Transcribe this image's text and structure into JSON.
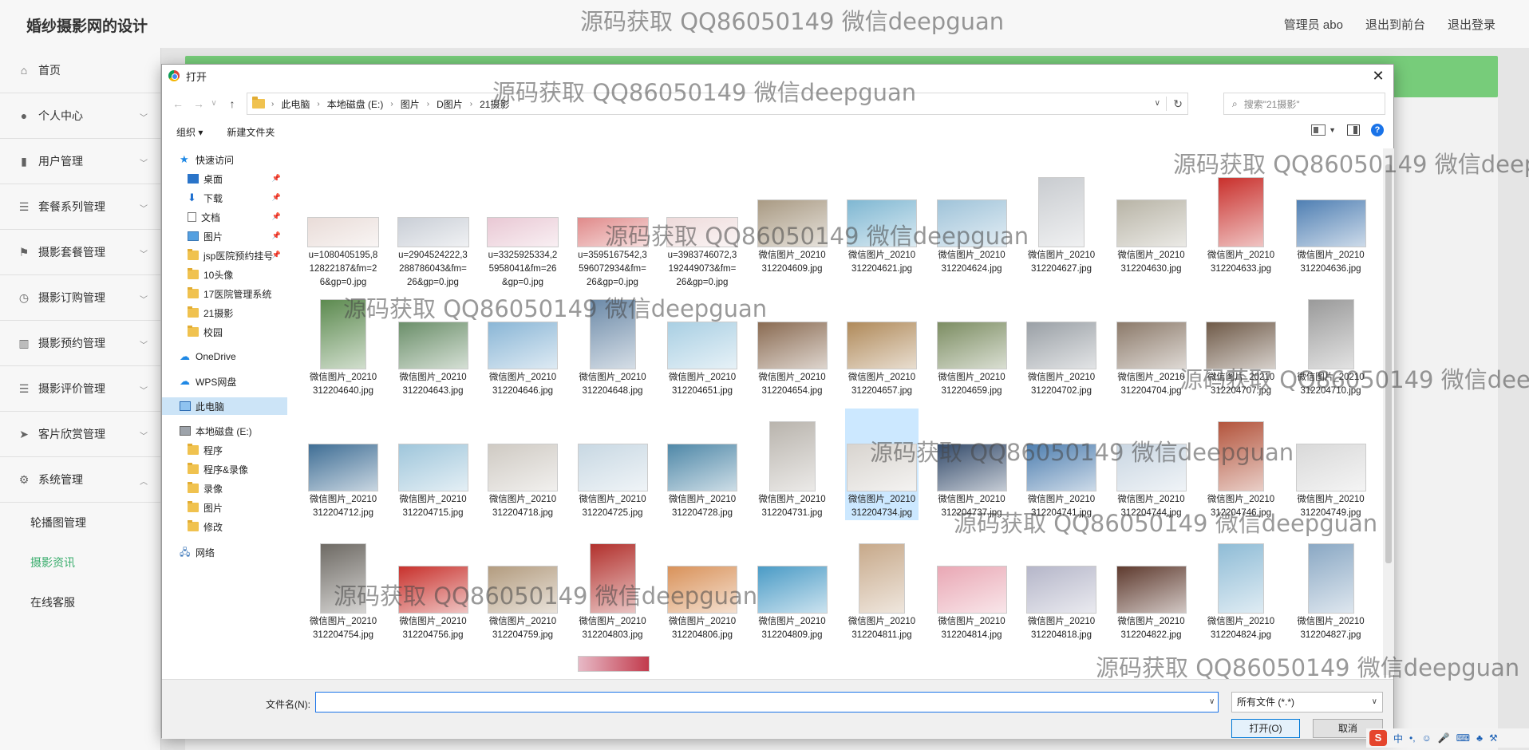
{
  "app": {
    "title": "婚纱摄影网的设计",
    "header_links": [
      "管理员 abo",
      "退出到前台",
      "退出登录"
    ],
    "sidebar": [
      {
        "label": "首页",
        "icon": "home-icon"
      },
      {
        "label": "个人中心",
        "icon": "user-icon"
      },
      {
        "label": "用户管理",
        "icon": "chart-icon"
      },
      {
        "label": "套餐系列管理",
        "icon": "list-icon"
      },
      {
        "label": "摄影套餐管理",
        "icon": "flag-icon"
      },
      {
        "label": "摄影订购管理",
        "icon": "clock-icon"
      },
      {
        "label": "摄影预约管理",
        "icon": "bars-icon"
      },
      {
        "label": "摄影评价管理",
        "icon": "list-icon"
      },
      {
        "label": "客片欣赏管理",
        "icon": "send-icon"
      },
      {
        "label": "系统管理",
        "icon": "gear-icon"
      }
    ],
    "sidebar_sub": [
      "轮播图管理",
      "摄影资讯",
      "在线客服"
    ],
    "sidebar_active_sub": "摄影资讯"
  },
  "dialog": {
    "title": "打开",
    "breadcrumb": [
      "此电脑",
      "本地磁盘 (E:)",
      "图片",
      "D图片",
      "21摄影"
    ],
    "search_placeholder": "搜索\"21摄影\"",
    "toolbar": {
      "organize": "组织 ▾",
      "new_folder": "新建文件夹"
    },
    "nav_items": [
      {
        "label": "快速访问",
        "icon": "star"
      },
      {
        "label": "桌面",
        "icon": "desktop",
        "pinned": true
      },
      {
        "label": "下载",
        "icon": "download",
        "pinned": true
      },
      {
        "label": "文档",
        "icon": "document",
        "pinned": true
      },
      {
        "label": "图片",
        "icon": "pictures",
        "pinned": true
      },
      {
        "label": "jsp医院预约挂号",
        "icon": "folder",
        "pinned": true
      },
      {
        "label": "10头像",
        "icon": "folder"
      },
      {
        "label": "17医院管理系统",
        "icon": "folder"
      },
      {
        "label": "21摄影",
        "icon": "folder"
      },
      {
        "label": "校园",
        "icon": "folder"
      },
      {
        "label": "OneDrive",
        "icon": "cloud"
      },
      {
        "label": "WPS网盘",
        "icon": "cloud"
      },
      {
        "label": "此电脑",
        "icon": "pc",
        "selected": true
      },
      {
        "label": "本地磁盘 (E:)",
        "icon": "drive"
      },
      {
        "label": "程序",
        "icon": "folder"
      },
      {
        "label": "程序&录像",
        "icon": "folder"
      },
      {
        "label": "录像",
        "icon": "folder"
      },
      {
        "label": "图片",
        "icon": "folder"
      },
      {
        "label": "修改",
        "icon": "folder"
      },
      {
        "label": "网络",
        "icon": "network"
      }
    ],
    "files": [
      {
        "name": "u=1080405195,812822187&fm=26&gp=0.jpg",
        "shape": "strip",
        "color": "#e9dcd8"
      },
      {
        "name": "u=2904524222,3288786043&fm=26&gp=0.jpg",
        "shape": "strip",
        "color": "#c9ced6"
      },
      {
        "name": "u=3325925334,25958041&fm=26&gp=0.jpg",
        "shape": "strip",
        "color": "#e9c8d4"
      },
      {
        "name": "u=3595167542,3596072934&fm=26&gp=0.jpg",
        "shape": "strip",
        "color": "#e08a8a"
      },
      {
        "name": "u=3983746072,3192449073&fm=26&gp=0.jpg",
        "shape": "strip",
        "color": "#eedada"
      },
      {
        "name": "微信图片_20210312204609.jpg",
        "shape": "wide",
        "color": "#a99a83"
      },
      {
        "name": "微信图片_20210312204621.jpg",
        "shape": "wide",
        "color": "#7fb7d2"
      },
      {
        "name": "微信图片_20210312204624.jpg",
        "shape": "wide",
        "color": "#9fc3d9"
      },
      {
        "name": "微信图片_20210312204627.jpg",
        "shape": "tall",
        "color": "#c9ccd0"
      },
      {
        "name": "微信图片_20210312204630.jpg",
        "shape": "wide",
        "color": "#b8b4a6"
      },
      {
        "name": "微信图片_20210312204633.jpg",
        "shape": "tall",
        "color": "#c9302c"
      },
      {
        "name": "微信图片_20210312204636.jpg",
        "shape": "wide",
        "color": "#4f7fb3"
      },
      {
        "name": "微信图片_20210312204640.jpg",
        "shape": "tall",
        "color": "#5c8a4f"
      },
      {
        "name": "微信图片_20210312204643.jpg",
        "shape": "wide",
        "color": "#6b8f6a"
      },
      {
        "name": "微信图片_20210312204646.jpg",
        "shape": "wide",
        "color": "#8ab6d6"
      },
      {
        "name": "微信图片_20210312204648.jpg",
        "shape": "tall",
        "color": "#6c8aa8"
      },
      {
        "name": "微信图片_20210312204651.jpg",
        "shape": "wide",
        "color": "#a9cfe3"
      },
      {
        "name": "微信图片_20210312204654.jpg",
        "shape": "wide",
        "color": "#8a6b52"
      },
      {
        "name": "微信图片_20210312204657.jpg",
        "shape": "wide",
        "color": "#b08a5a"
      },
      {
        "name": "微信图片_20210312204659.jpg",
        "shape": "wide",
        "color": "#7c8d62"
      },
      {
        "name": "微信图片_20210312204702.jpg",
        "shape": "wide",
        "color": "#9aa0a6"
      },
      {
        "name": "微信图片_20210312204704.jpg",
        "shape": "wide",
        "color": "#8c7a6a"
      },
      {
        "name": "微信图片_20210312204707.jpg",
        "shape": "wide",
        "color": "#6f5a48"
      },
      {
        "name": "微信图片_20210312204710.jpg",
        "shape": "tall",
        "color": "#9a9a9a"
      },
      {
        "name": "微信图片_20210312204712.jpg",
        "shape": "wide",
        "color": "#3f6e95"
      },
      {
        "name": "微信图片_20210312204715.jpg",
        "shape": "wide",
        "color": "#9fc6db"
      },
      {
        "name": "微信图片_20210312204718.jpg",
        "shape": "wide",
        "color": "#cfcac3"
      },
      {
        "name": "微信图片_20210312204725.jpg",
        "shape": "wide",
        "color": "#c8d8e3"
      },
      {
        "name": "微信图片_20210312204728.jpg",
        "shape": "wide",
        "color": "#4f88a8"
      },
      {
        "name": "微信图片_20210312204731.jpg",
        "shape": "tall",
        "color": "#b9b4ad"
      },
      {
        "name": "微信图片_20210312204734.jpg",
        "shape": "wide",
        "color": "#d8d4cf",
        "selected": true
      },
      {
        "name": "微信图片_20210312204737.jpg",
        "shape": "wide",
        "color": "#334a6a"
      },
      {
        "name": "微信图片_20210312204741.jpg",
        "shape": "wide",
        "color": "#4f7fb0"
      },
      {
        "name": "微信图片_20210312204744.jpg",
        "shape": "wide",
        "color": "#c9d6e2"
      },
      {
        "name": "微信图片_20210312204746.jpg",
        "shape": "tall",
        "color": "#b3543c"
      },
      {
        "name": "微信图片_20210312204749.jpg",
        "shape": "wide",
        "color": "#d9d9d9"
      },
      {
        "name": "微信图片_20210312204754.jpg",
        "shape": "tall",
        "color": "#6e6a64"
      },
      {
        "name": "微信图片_20210312204756.jpg",
        "shape": "wide",
        "color": "#c8312c"
      },
      {
        "name": "微信图片_20210312204759.jpg",
        "shape": "wide",
        "color": "#b39c7f"
      },
      {
        "name": "微信图片_20210312204803.jpg",
        "shape": "tall",
        "color": "#b2312d"
      },
      {
        "name": "微信图片_20210312204806.jpg",
        "shape": "wide",
        "color": "#d9925a"
      },
      {
        "name": "微信图片_20210312204809.jpg",
        "shape": "wide",
        "color": "#4a9bc6"
      },
      {
        "name": "微信图片_20210312204811.jpg",
        "shape": "tall",
        "color": "#c7a98a"
      },
      {
        "name": "微信图片_20210312204814.jpg",
        "shape": "wide",
        "color": "#e9a7b4"
      },
      {
        "name": "微信图片_20210312204818.jpg",
        "shape": "wide",
        "color": "#b5b6c9"
      },
      {
        "name": "微信图片_20210312204822.jpg",
        "shape": "wide",
        "color": "#5e3a2e"
      },
      {
        "name": "微信图片_20210312204824.jpg",
        "shape": "tall",
        "color": "#8fbcd6"
      },
      {
        "name": "微信图片_20210312204827.jpg",
        "shape": "tall",
        "color": "#8aa8c4"
      }
    ],
    "filename_label": "文件名(N):",
    "filename_value": "",
    "filetype_value": "所有文件 (*.*)",
    "open_button": "打开(O)",
    "cancel_button": "取消"
  },
  "ime": {
    "logo": "S",
    "mode": "中"
  },
  "watermark": "源码获取 QQ86050149 微信deepguan"
}
